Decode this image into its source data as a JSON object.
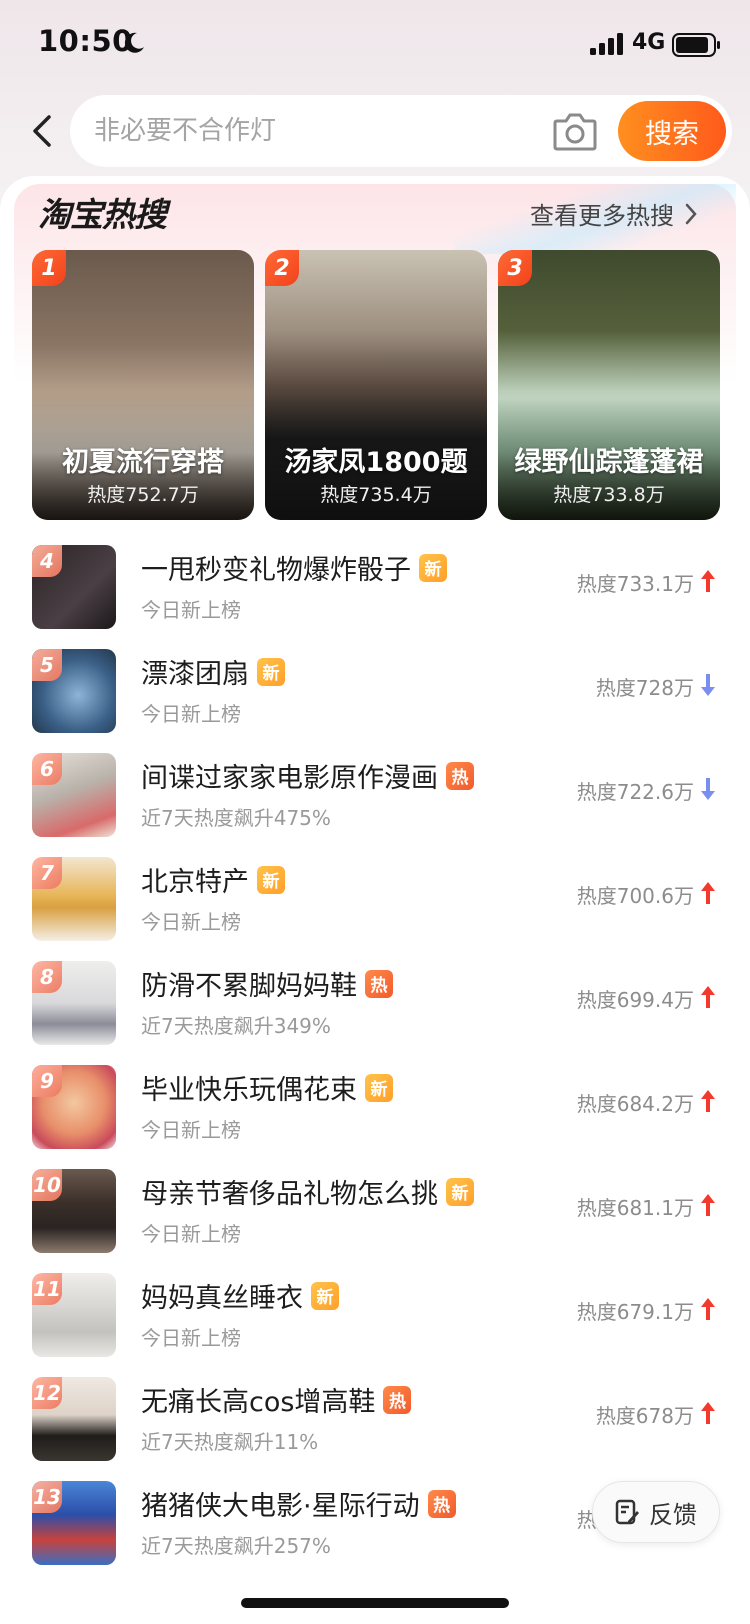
{
  "status": {
    "time": "10:50",
    "network": "4G"
  },
  "search": {
    "placeholder": "非必要不合作灯",
    "button_label": "搜索"
  },
  "hot": {
    "logo": "淘宝热搜",
    "more_label": "查看更多热搜"
  },
  "top_items": [
    {
      "rank": "1",
      "title": "初夏流行穿搭",
      "heat": "热度752.7万"
    },
    {
      "rank": "2",
      "title": "汤家凤1800题",
      "heat": "热度735.4万"
    },
    {
      "rank": "3",
      "title": "绿野仙踪蓬蓬裙",
      "heat": "热度733.8万"
    }
  ],
  "list": [
    {
      "rank": "4",
      "title": "一甩秒变礼物爆炸骰子",
      "tag": "新",
      "sub": "今日新上榜",
      "heat": "热度733.1万",
      "trend": "up"
    },
    {
      "rank": "5",
      "title": "漂漆团扇",
      "tag": "新",
      "sub": "今日新上榜",
      "heat": "热度728万",
      "trend": "down"
    },
    {
      "rank": "6",
      "title": "间谍过家家电影原作漫画",
      "tag": "热",
      "sub": "近7天热度飙升475%",
      "heat": "热度722.6万",
      "trend": "down"
    },
    {
      "rank": "7",
      "title": "北京特产",
      "tag": "新",
      "sub": "今日新上榜",
      "heat": "热度700.6万",
      "trend": "up"
    },
    {
      "rank": "8",
      "title": "防滑不累脚妈妈鞋",
      "tag": "热",
      "sub": "近7天热度飙升349%",
      "heat": "热度699.4万",
      "trend": "up"
    },
    {
      "rank": "9",
      "title": "毕业快乐玩偶花束",
      "tag": "新",
      "sub": "今日新上榜",
      "heat": "热度684.2万",
      "trend": "up"
    },
    {
      "rank": "10",
      "title": "母亲节奢侈品礼物怎么挑",
      "tag": "新",
      "sub": "今日新上榜",
      "heat": "热度681.1万",
      "trend": "up"
    },
    {
      "rank": "11",
      "title": "妈妈真丝睡衣",
      "tag": "新",
      "sub": "今日新上榜",
      "heat": "热度679.1万",
      "trend": "up"
    },
    {
      "rank": "12",
      "title": "无痛长高cos增高鞋",
      "tag": "热",
      "sub": "近7天热度飙升11%",
      "heat": "热度678万",
      "trend": "up"
    },
    {
      "rank": "13",
      "title": "猪猪侠大电影·星际行动",
      "tag": "热",
      "sub": "近7天热度飙升257%",
      "heat": "热度669.6万",
      "trend": "up"
    }
  ],
  "feedback": {
    "label": "反馈"
  },
  "colors": {
    "accent": "#ff6a1f",
    "trend_up": "#f2392b",
    "trend_down": "#7a8ef0"
  },
  "icons": [
    "moon-icon",
    "signal-icon",
    "battery-icon",
    "back-arrow-icon",
    "camera-icon",
    "chevron-right-icon",
    "trend-up-icon",
    "trend-down-icon",
    "feedback-edit-icon"
  ]
}
